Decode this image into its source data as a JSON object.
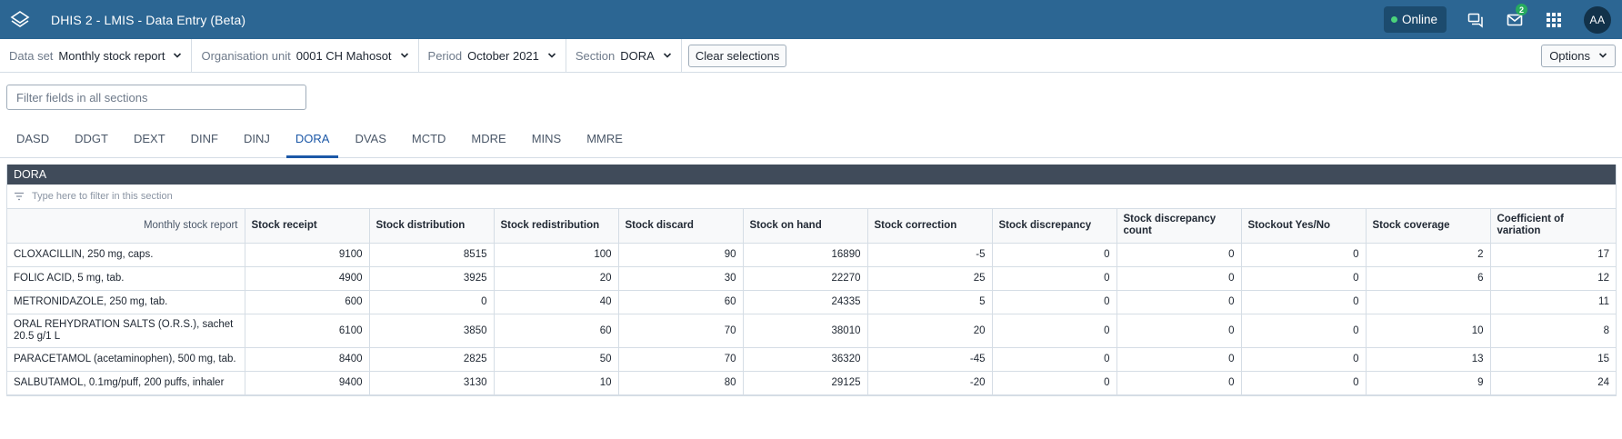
{
  "header": {
    "title": "DHIS 2 - LMIS - Data Entry (Beta)",
    "status": "Online",
    "messages_badge": "2",
    "avatar_initials": "AA"
  },
  "context": {
    "dataset_label": "Data set",
    "dataset_value": "Monthly stock report",
    "orgunit_label": "Organisation unit",
    "orgunit_value": "0001 CH Mahosot",
    "period_label": "Period",
    "period_value": "October 2021",
    "section_label": "Section",
    "section_value": "DORA",
    "clear_label": "Clear selections",
    "options_label": "Options"
  },
  "filter": {
    "placeholder": "Filter fields in all sections"
  },
  "tabs": [
    {
      "label": "DASD"
    },
    {
      "label": "DDGT"
    },
    {
      "label": "DEXT"
    },
    {
      "label": "DINF"
    },
    {
      "label": "DINJ"
    },
    {
      "label": "DORA"
    },
    {
      "label": "DVAS"
    },
    {
      "label": "MCTD"
    },
    {
      "label": "MDRE"
    },
    {
      "label": "MINS"
    },
    {
      "label": "MMRE"
    }
  ],
  "active_tab": "DORA",
  "section": {
    "title": "DORA",
    "filter_placeholder": "Type here to filter in this section",
    "columns": [
      "Monthly stock report",
      "Stock receipt",
      "Stock distribution",
      "Stock redistribution",
      "Stock discard",
      "Stock on hand",
      "Stock correction",
      "Stock discrepancy",
      "Stock discrepancy count",
      "Stockout Yes/No",
      "Stock coverage",
      "Coefficient of variation"
    ],
    "rows": [
      {
        "label": "CLOXACILLIN, 250 mg, caps.",
        "values": [
          "9100",
          "8515",
          "100",
          "90",
          "16890",
          "-5",
          "0",
          "0",
          "0",
          "2",
          "17"
        ]
      },
      {
        "label": "FOLIC ACID, 5 mg, tab.",
        "values": [
          "4900",
          "3925",
          "20",
          "30",
          "22270",
          "25",
          "0",
          "0",
          "0",
          "6",
          "12"
        ]
      },
      {
        "label": "METRONIDAZOLE, 250 mg, tab.",
        "values": [
          "600",
          "0",
          "40",
          "60",
          "24335",
          "5",
          "0",
          "0",
          "0",
          "",
          "11"
        ]
      },
      {
        "label": "ORAL REHYDRATION SALTS (O.R.S.), sachet 20.5 g/1 L",
        "values": [
          "6100",
          "3850",
          "60",
          "70",
          "38010",
          "20",
          "0",
          "0",
          "0",
          "10",
          "8"
        ]
      },
      {
        "label": "PARACETAMOL (acetaminophen), 500 mg, tab.",
        "values": [
          "8400",
          "2825",
          "50",
          "70",
          "36320",
          "-45",
          "0",
          "0",
          "0",
          "13",
          "15"
        ]
      },
      {
        "label": "SALBUTAMOL, 0.1mg/puff, 200 puffs, inhaler",
        "values": [
          "9400",
          "3130",
          "10",
          "80",
          "29125",
          "-20",
          "0",
          "0",
          "0",
          "9",
          "24"
        ]
      }
    ]
  }
}
